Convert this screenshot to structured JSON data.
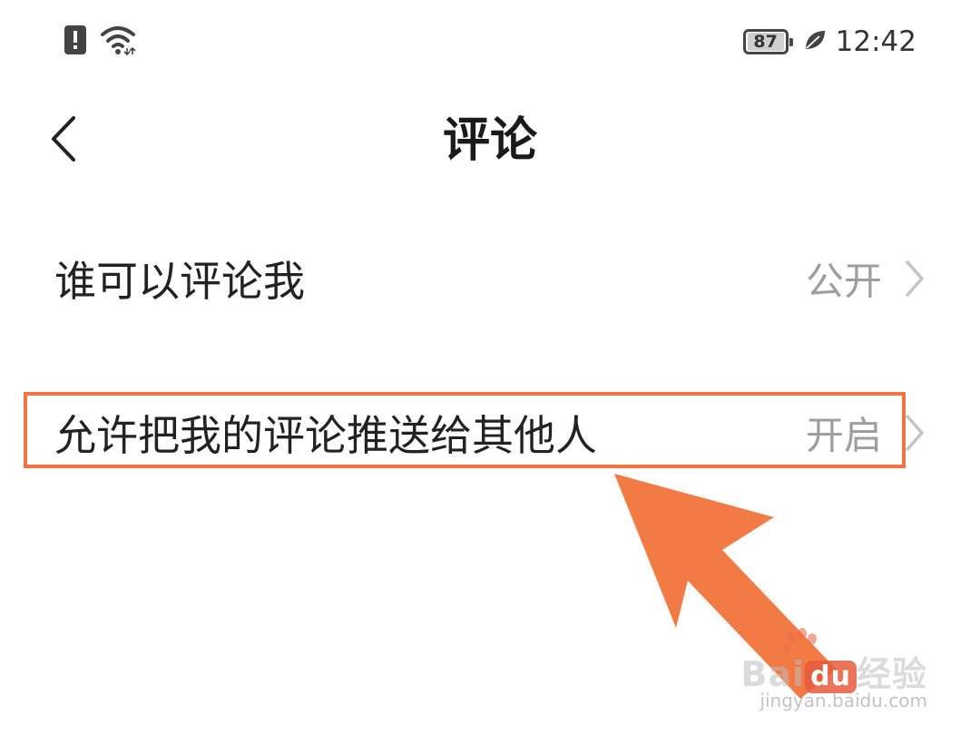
{
  "status_bar": {
    "battery_level": "87",
    "time": "12:42",
    "icons": [
      "notification-alert-icon",
      "wifi-icon",
      "battery-icon",
      "leaf-icon"
    ]
  },
  "nav": {
    "title": "评论",
    "back_icon": "chevron-left-icon"
  },
  "settings": [
    {
      "label": "谁可以评论我",
      "value": "公开"
    },
    {
      "label": "允许把我的评论推送给其他人",
      "value": "开启"
    }
  ],
  "annotation": {
    "color": "#f07541",
    "highlighted_row": 1
  },
  "watermark": {
    "brand_left": "Bai",
    "brand_badge": "du",
    "brand_right": "经验",
    "url": "jingyan.baidu.com"
  }
}
